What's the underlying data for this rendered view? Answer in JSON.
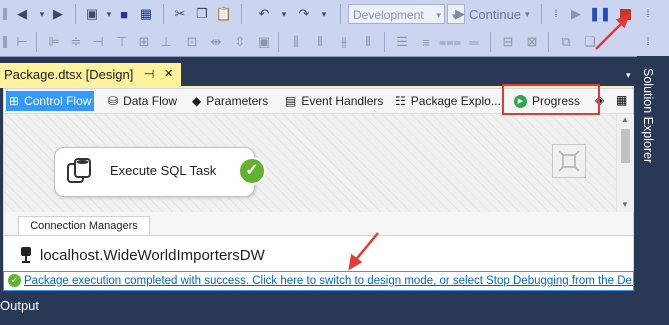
{
  "toolbar": {
    "config_dropdown": "Development",
    "continue_label": "Continue"
  },
  "document": {
    "tab_title": "Package.dtsx [Design]",
    "pin_glyph": "⊣",
    "close_glyph": "✕"
  },
  "designer_tabs": [
    {
      "label": "Control Flow",
      "icon": "control-flow-icon"
    },
    {
      "label": "Data Flow",
      "icon": "data-flow-icon"
    },
    {
      "label": "Parameters",
      "icon": "parameters-icon"
    },
    {
      "label": "Event Handlers",
      "icon": "event-handlers-icon"
    },
    {
      "label": "Package Explo...",
      "icon": "package-explorer-icon"
    },
    {
      "label": "Progress",
      "icon": "progress-play-icon"
    }
  ],
  "canvas": {
    "task_label": "Execute SQL Task",
    "task_status": "success"
  },
  "connection_managers": {
    "tab_label": "Connection Managers",
    "items": [
      "localhost.WideWorldImportersDW"
    ]
  },
  "status_bar": {
    "message": "Package execution completed with success. Click here to switch to design mode, or select Stop Debugging from the De..."
  },
  "panels": {
    "output_label": "Output",
    "solution_explorer_label": "Solution Explorer"
  },
  "colors": {
    "accent": "#3399ff",
    "success": "#62b22f",
    "annotation": "#e53935",
    "stop": "#c0392b"
  }
}
